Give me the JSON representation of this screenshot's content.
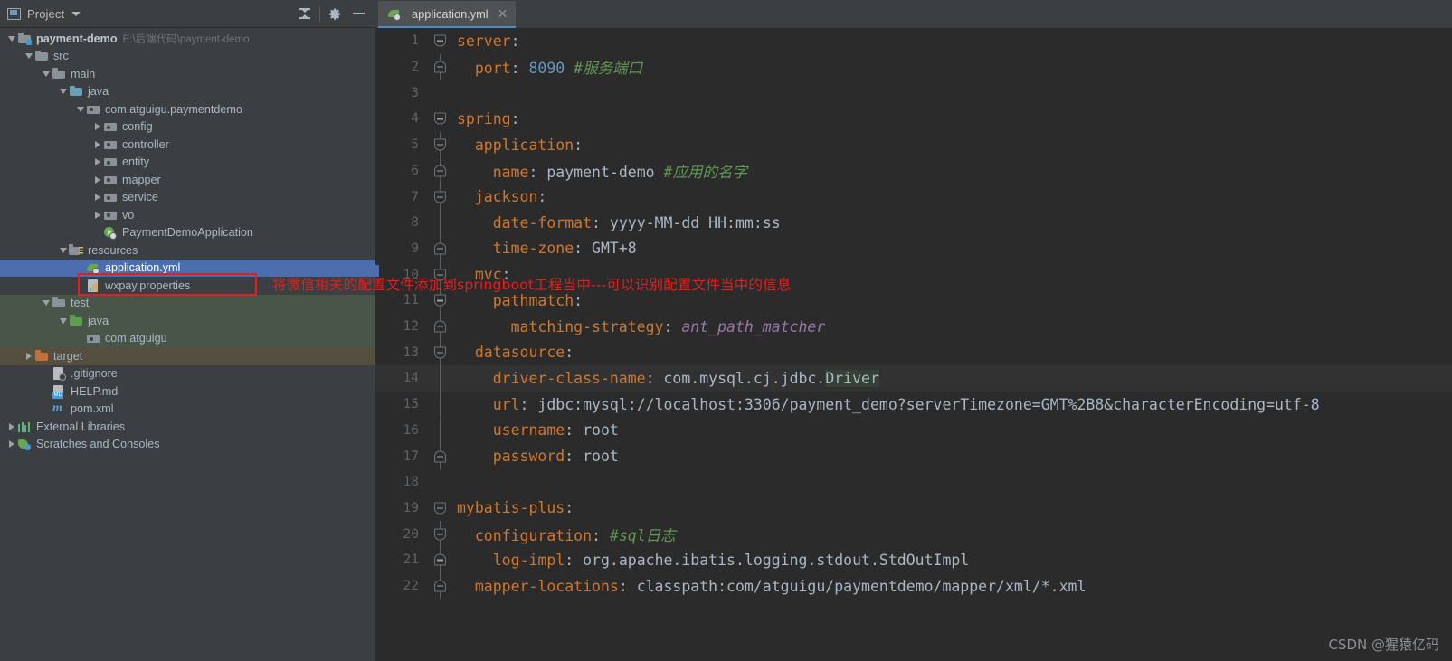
{
  "project_panel": {
    "title": "Project",
    "window_icon": "project-window-icon",
    "caret_icon": "chevron-down-icon",
    "tools": [
      {
        "name": "collapse-all-icon",
        "label": "Collapse All"
      },
      {
        "name": "gear-icon",
        "label": "Settings"
      },
      {
        "name": "minimize-icon",
        "label": "Hide"
      }
    ],
    "tree": [
      {
        "id": "payment-demo",
        "label": "payment-demo",
        "secondary": "E:\\后端代码\\payment-demo",
        "depth": 0,
        "arrow": "expanded",
        "icon": "module-icon",
        "bold": true,
        "state": "normal"
      },
      {
        "id": "src",
        "label": "src",
        "secondary": "",
        "depth": 1,
        "arrow": "expanded",
        "icon": "folder-icon",
        "bold": false,
        "state": "normal"
      },
      {
        "id": "main",
        "label": "main",
        "secondary": "",
        "depth": 2,
        "arrow": "expanded",
        "icon": "folder-icon",
        "bold": false,
        "state": "normal"
      },
      {
        "id": "java",
        "label": "java",
        "secondary": "",
        "depth": 3,
        "arrow": "expanded",
        "icon": "source-folder-icon",
        "bold": false,
        "state": "normal"
      },
      {
        "id": "com-atguigu-paymentdemo",
        "label": "com.atguigu.paymentdemo",
        "secondary": "",
        "depth": 4,
        "arrow": "expanded",
        "icon": "package-icon",
        "bold": false,
        "state": "normal"
      },
      {
        "id": "config",
        "label": "config",
        "secondary": "",
        "depth": 5,
        "arrow": "collapsed",
        "icon": "package-icon",
        "bold": false,
        "state": "normal"
      },
      {
        "id": "controller",
        "label": "controller",
        "secondary": "",
        "depth": 5,
        "arrow": "collapsed",
        "icon": "package-icon",
        "bold": false,
        "state": "normal"
      },
      {
        "id": "entity",
        "label": "entity",
        "secondary": "",
        "depth": 5,
        "arrow": "collapsed",
        "icon": "package-icon",
        "bold": false,
        "state": "normal"
      },
      {
        "id": "mapper",
        "label": "mapper",
        "secondary": "",
        "depth": 5,
        "arrow": "collapsed",
        "icon": "package-icon",
        "bold": false,
        "state": "normal"
      },
      {
        "id": "service",
        "label": "service",
        "secondary": "",
        "depth": 5,
        "arrow": "collapsed",
        "icon": "package-icon",
        "bold": false,
        "state": "normal"
      },
      {
        "id": "vo",
        "label": "vo",
        "secondary": "",
        "depth": 5,
        "arrow": "collapsed",
        "icon": "package-icon",
        "bold": false,
        "state": "normal"
      },
      {
        "id": "payment-demo-application",
        "label": "PaymentDemoApplication",
        "secondary": "",
        "depth": 5,
        "arrow": "none",
        "icon": "spring-boot-class-icon",
        "bold": false,
        "state": "normal"
      },
      {
        "id": "resources",
        "label": "resources",
        "secondary": "",
        "depth": 3,
        "arrow": "expanded",
        "icon": "resources-folder-icon",
        "bold": false,
        "state": "normal"
      },
      {
        "id": "application-yml",
        "label": "application.yml",
        "secondary": "",
        "depth": 4,
        "arrow": "none",
        "icon": "spring-yaml-icon",
        "bold": false,
        "state": "selected"
      },
      {
        "id": "wxpay-properties",
        "label": "wxpay.properties",
        "secondary": "",
        "depth": 4,
        "arrow": "none",
        "icon": "properties-file-icon",
        "bold": false,
        "state": "normal"
      },
      {
        "id": "test",
        "label": "test",
        "secondary": "",
        "depth": 2,
        "arrow": "expanded",
        "icon": "folder-icon",
        "bold": false,
        "state": "test-tint"
      },
      {
        "id": "test-java",
        "label": "java",
        "secondary": "",
        "depth": 3,
        "arrow": "expanded",
        "icon": "test-source-folder-icon",
        "bold": false,
        "state": "test-tint"
      },
      {
        "id": "test-com-atguigu",
        "label": "com.atguigu",
        "secondary": "",
        "depth": 4,
        "arrow": "none",
        "icon": "package-icon",
        "bold": false,
        "state": "test-tint"
      },
      {
        "id": "target",
        "label": "target",
        "secondary": "",
        "depth": 1,
        "arrow": "collapsed",
        "icon": "excluded-folder-icon",
        "bold": false,
        "state": "target-tint"
      },
      {
        "id": "gitignore",
        "label": ".gitignore",
        "secondary": "",
        "depth": 2,
        "arrow": "none",
        "icon": "gitignore-file-icon",
        "bold": false,
        "state": "normal"
      },
      {
        "id": "help-md",
        "label": "HELP.md",
        "secondary": "",
        "depth": 2,
        "arrow": "none",
        "icon": "markdown-file-icon",
        "bold": false,
        "state": "normal"
      },
      {
        "id": "pom-xml",
        "label": "pom.xml",
        "secondary": "",
        "depth": 2,
        "arrow": "none",
        "icon": "maven-file-icon",
        "bold": false,
        "state": "normal"
      },
      {
        "id": "external-libraries",
        "label": "External Libraries",
        "secondary": "",
        "depth": 0,
        "arrow": "collapsed",
        "icon": "libraries-icon",
        "bold": false,
        "state": "normal"
      },
      {
        "id": "scratches-and-consoles",
        "label": "Scratches and Consoles",
        "secondary": "",
        "depth": 0,
        "arrow": "collapsed",
        "icon": "scratches-icon",
        "bold": false,
        "state": "normal"
      }
    ]
  },
  "annotation": {
    "text": "将微信相关的配置文件添加到springboot工程当中---可以识别配置文件当中的信息",
    "color": "#e81e1e",
    "box_target": "wxpay.properties"
  },
  "editor": {
    "tab": {
      "label": "application.yml",
      "icon": "spring-yaml-icon",
      "close_icon": "close-icon"
    },
    "lines": [
      {
        "n": "1",
        "fold": "start",
        "vline": false,
        "tokens": [
          {
            "t": "server",
            "c": "k"
          },
          {
            "t": ":",
            "c": "p"
          }
        ]
      },
      {
        "n": "2",
        "fold": "end",
        "vline": true,
        "tokens": [
          {
            "t": "  port",
            "c": "k"
          },
          {
            "t": ": ",
            "c": "p"
          },
          {
            "t": "8090",
            "c": "num"
          },
          {
            "t": " ",
            "c": "p"
          },
          {
            "t": "#服务端口",
            "c": "cm"
          }
        ]
      },
      {
        "n": "3",
        "fold": "none",
        "vline": false,
        "tokens": []
      },
      {
        "n": "4",
        "fold": "start",
        "vline": false,
        "tokens": [
          {
            "t": "spring",
            "c": "k"
          },
          {
            "t": ":",
            "c": "p"
          }
        ]
      },
      {
        "n": "5",
        "fold": "start",
        "vline": true,
        "tokens": [
          {
            "t": "  application",
            "c": "k"
          },
          {
            "t": ":",
            "c": "p"
          }
        ]
      },
      {
        "n": "6",
        "fold": "end",
        "vline": true,
        "tokens": [
          {
            "t": "    name",
            "c": "k"
          },
          {
            "t": ": ",
            "c": "p"
          },
          {
            "t": "payment-demo",
            "c": "s"
          },
          {
            "t": " ",
            "c": "p"
          },
          {
            "t": "#应用的名字",
            "c": "cm"
          }
        ]
      },
      {
        "n": "7",
        "fold": "start",
        "vline": true,
        "tokens": [
          {
            "t": "  jackson",
            "c": "k"
          },
          {
            "t": ":",
            "c": "p"
          }
        ]
      },
      {
        "n": "8",
        "fold": "none",
        "vline": true,
        "tokens": [
          {
            "t": "    date-format",
            "c": "k"
          },
          {
            "t": ": ",
            "c": "p"
          },
          {
            "t": "yyyy-MM-dd HH:mm:ss",
            "c": "s"
          }
        ]
      },
      {
        "n": "9",
        "fold": "end",
        "vline": true,
        "tokens": [
          {
            "t": "    time-zone",
            "c": "k"
          },
          {
            "t": ": ",
            "c": "p"
          },
          {
            "t": "GMT+8",
            "c": "s"
          }
        ]
      },
      {
        "n": "10",
        "fold": "start",
        "vline": true,
        "tokens": [
          {
            "t": "  mvc",
            "c": "k"
          },
          {
            "t": ":",
            "c": "p"
          }
        ]
      },
      {
        "n": "11",
        "fold": "start",
        "vline": true,
        "tokens": [
          {
            "t": "    pathmatch",
            "c": "k"
          },
          {
            "t": ":",
            "c": "p"
          }
        ]
      },
      {
        "n": "12",
        "fold": "end",
        "vline": true,
        "tokens": [
          {
            "t": "      matching-strategy",
            "c": "k"
          },
          {
            "t": ": ",
            "c": "p"
          },
          {
            "t": "ant_path_matcher",
            "c": "id"
          }
        ]
      },
      {
        "n": "13",
        "fold": "start",
        "vline": true,
        "tokens": [
          {
            "t": "  datasource",
            "c": "k"
          },
          {
            "t": ":",
            "c": "p"
          }
        ]
      },
      {
        "n": "14",
        "fold": "none",
        "vline": true,
        "tokens": [
          {
            "t": "    driver-class-name",
            "c": "k"
          },
          {
            "t": ": ",
            "c": "p"
          },
          {
            "t": "com.mysql.cj.jdbc.",
            "c": "s"
          },
          {
            "t": "Driver",
            "c": "s hl"
          }
        ],
        "current": true
      },
      {
        "n": "15",
        "fold": "none",
        "vline": true,
        "tokens": [
          {
            "t": "    url",
            "c": "k"
          },
          {
            "t": ": ",
            "c": "p"
          },
          {
            "t": "jdbc:mysql://localhost:3306/payment_demo?serverTimezone=GMT%2B8&characterEncoding=utf-8",
            "c": "s"
          }
        ]
      },
      {
        "n": "16",
        "fold": "none",
        "vline": true,
        "tokens": [
          {
            "t": "    username",
            "c": "k"
          },
          {
            "t": ": ",
            "c": "p"
          },
          {
            "t": "root",
            "c": "s"
          }
        ]
      },
      {
        "n": "17",
        "fold": "end",
        "vline": true,
        "tokens": [
          {
            "t": "    password",
            "c": "k"
          },
          {
            "t": ": ",
            "c": "p"
          },
          {
            "t": "root",
            "c": "s"
          }
        ]
      },
      {
        "n": "18",
        "fold": "none",
        "vline": false,
        "tokens": []
      },
      {
        "n": "19",
        "fold": "start",
        "vline": false,
        "tokens": [
          {
            "t": "mybatis-plus",
            "c": "k"
          },
          {
            "t": ":",
            "c": "p"
          }
        ]
      },
      {
        "n": "20",
        "fold": "start",
        "vline": true,
        "tokens": [
          {
            "t": "  configuration",
            "c": "k"
          },
          {
            "t": ": ",
            "c": "p"
          },
          {
            "t": "#sql日志",
            "c": "cm"
          }
        ]
      },
      {
        "n": "21",
        "fold": "end",
        "vline": true,
        "tokens": [
          {
            "t": "    log-impl",
            "c": "k"
          },
          {
            "t": ": ",
            "c": "p"
          },
          {
            "t": "org.apache.ibatis.logging.stdout.StdOutImpl",
            "c": "s"
          }
        ]
      },
      {
        "n": "22",
        "fold": "end",
        "vline": true,
        "tokens": [
          {
            "t": "  mapper-locations",
            "c": "k"
          },
          {
            "t": ": ",
            "c": "p"
          },
          {
            "t": "classpath:com/atguigu/paymentdemo/mapper/xml/*.xml",
            "c": "s"
          }
        ]
      }
    ]
  },
  "watermark": "CSDN @猩猿亿码",
  "colors": {
    "panel_bg": "#3c3f41",
    "editor_bg": "#2b2b2b",
    "selection": "#4b6eaf",
    "key": "#cc7832",
    "string": "#a9b7c6",
    "number": "#6897bb",
    "comment": "#629755",
    "annotation": "#e81e1e"
  }
}
